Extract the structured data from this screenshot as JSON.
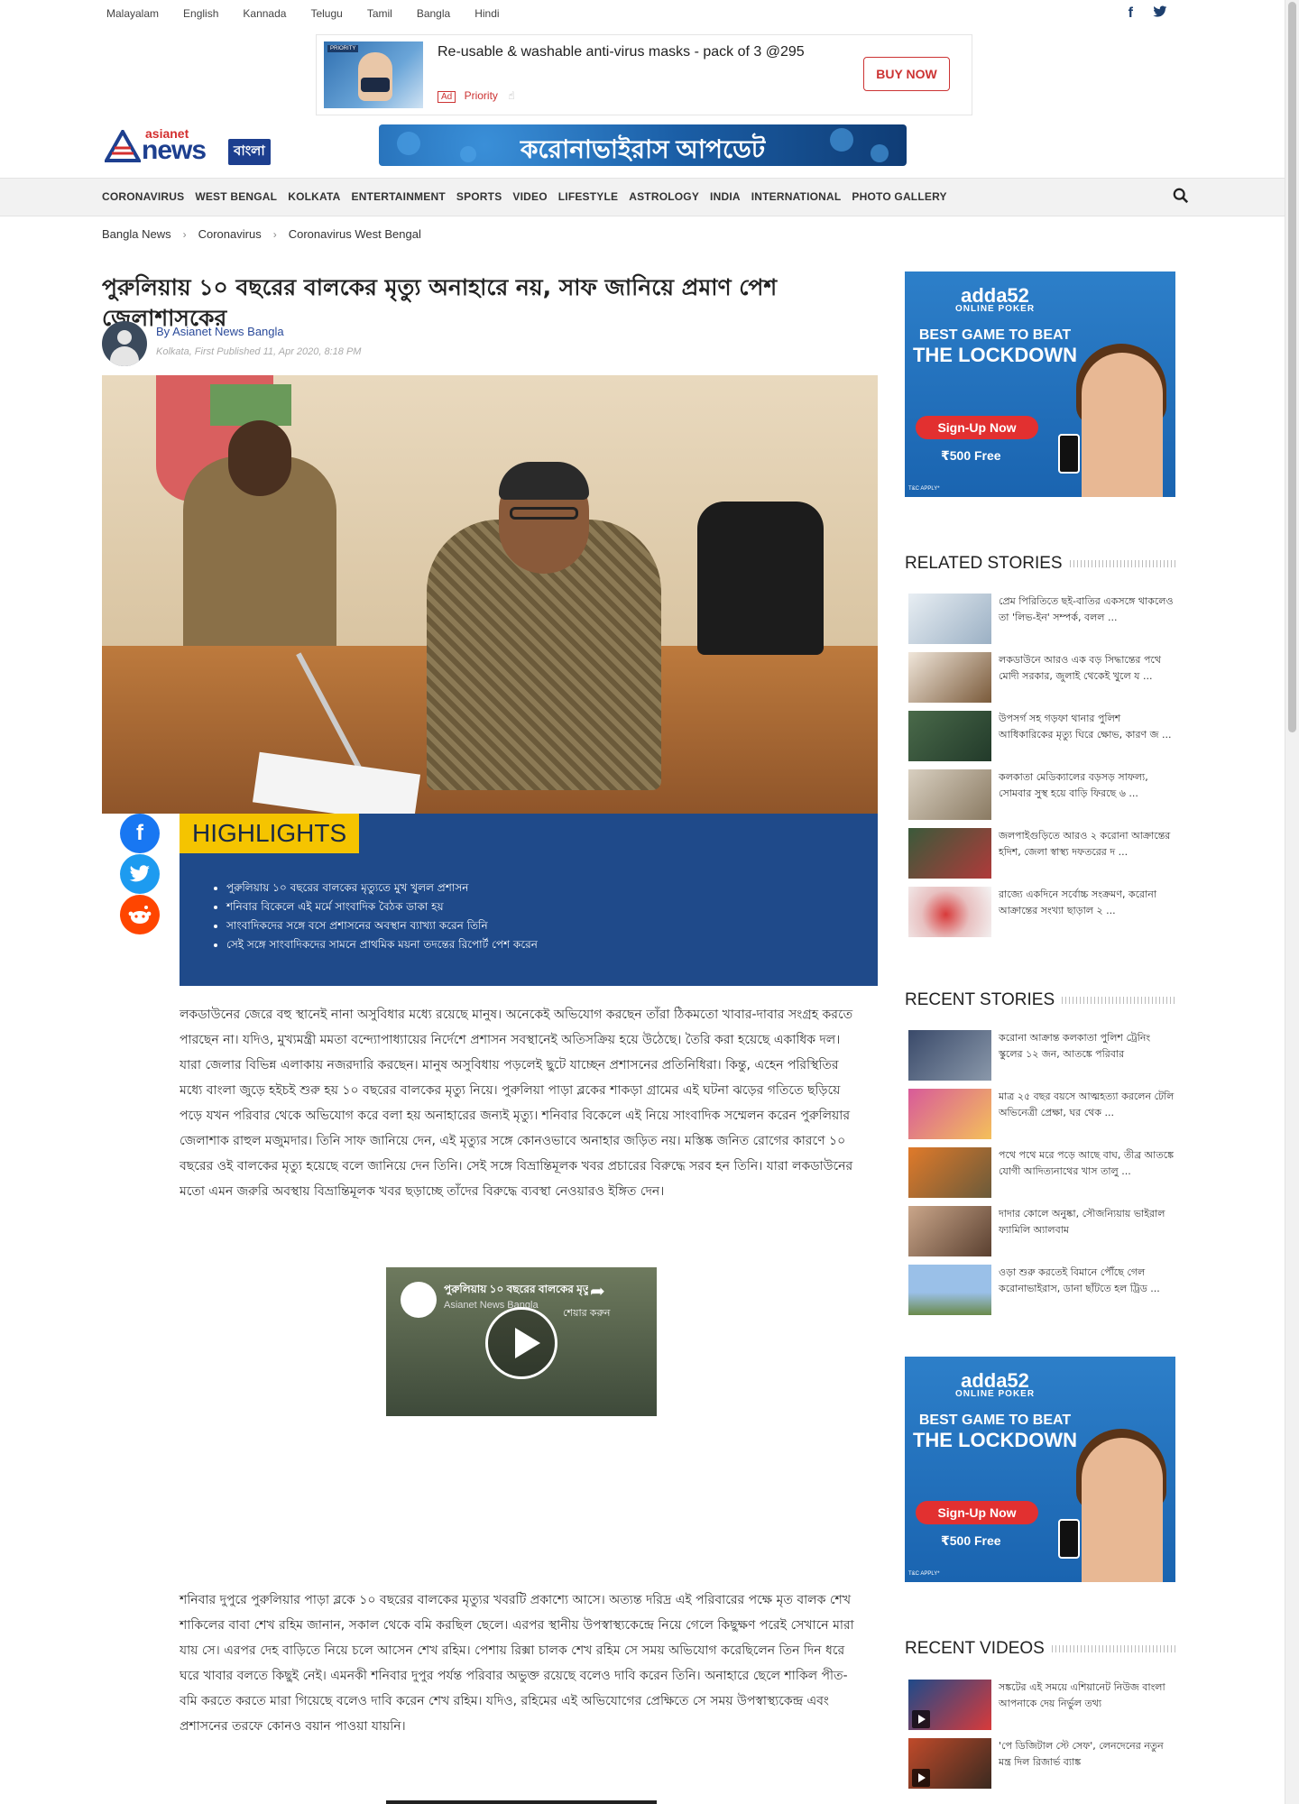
{
  "languages": [
    "Malayalam",
    "English",
    "Kannada",
    "Telugu",
    "Tamil",
    "Bangla",
    "Hindi"
  ],
  "social": {
    "facebook": "f",
    "twitter": "t"
  },
  "top_ad": {
    "thumb_tag": "PRIORITY",
    "title": "Re-usable & washable anti-virus masks - pack of 3 @295",
    "ad_badge": "Ad",
    "brand": "Priority",
    "button": "BUY NOW"
  },
  "logo": {
    "top": "asianet",
    "main": "news",
    "lang": "বাংলা"
  },
  "covid_banner": "করোনাভাইরাস আপডেট",
  "nav": [
    "CORONAVIRUS",
    "WEST BENGAL",
    "KOLKATA",
    "ENTERTAINMENT",
    "SPORTS",
    "VIDEO",
    "LIFESTYLE",
    "ASTROLOGY",
    "INDIA",
    "INTERNATIONAL",
    "PHOTO GALLERY"
  ],
  "breadcrumbs": [
    "Bangla News",
    "Coronavirus",
    "Coronavirus West Bengal"
  ],
  "article": {
    "headline": "পুরুলিয়ায় ১০ বছরের বালকের মৃত্যু অনাহারে নয়, সাফ জানিয়ে প্রমাণ পেশ জেলাশাসকের",
    "author": "By Asianet News Bangla",
    "date": "Kolkata, First Published 11, Apr 2020, 8:18 PM",
    "highlights_label": "HIGHLIGHTS",
    "highlights": [
      "পুরুলিয়ায় ১০ বছরের বালকের মৃত্যুতে মুখ খুলল প্রশাসন",
      "শনিবার বিকেলে এই মর্মে সাংবাদিক বৈঠক ডাকা হয়",
      "সাংবাদিকদের সঙ্গে বসে প্রশাসনের অবস্থান ব্যাখ্যা করেন তিনি",
      "সেই সঙ্গে সাংবাদিকদের সামনে প্রাথমিক ময়না তদন্তের রিপোর্ট পেশ করেন"
    ],
    "para1": "লকডাউনের জেরে বহু স্থানেই নানা অসুবিধার মধ্যে রয়েছে মানুষ। অনেকেই অভিযোগ করছেন তাঁরা ঠিকমতো খাবার-দাবার সংগ্রহ করতে পারছেন না। যদিও, মুখ্যমন্ত্রী মমতা বন্দ্যোপাধ্যায়ের নির্দেশে প্রশাসন সবস্থানেই অতিসক্রিয় হয়ে উঠেছে। তৈরি করা হয়েছে একাধিক দল। যারা জেলার বিভিন্ন এলাকায় নজরদারি করছেন। মানুষ অসুবিধায় পড়লেই ছুটে যাচ্ছেন প্রশাসনের প্রতিনিধিরা। কিন্তু, এহেন পরিস্থিতির মধ্যে বাংলা জুড়ে হইচই শুরু হয় ১০ বছরের বালকের মৃত্যু নিয়ে। পুরুলিয়া পাড়া ব্লকের শাকড়া গ্রামের এই ঘটনা ঝড়ের গতিতে ছড়িয়ে পড়ে যখন পরিবার থেকে অভিযোগ করে বলা হয় অনাহারের জন্যই মৃত্যু। শনিবার বিকেলে এই নিয়ে সাংবাদিক সম্মেলন করেন পুরুলিয়ার জেলাশাক রাহুল মজুমদার। তিনি সাফ জানিয়ে দেন, এই মৃত্যুর সঙ্গে কোনওভাবে অনাহার জড়িত নয়। মস্তিষ্ক জনিত রোগের কারণে ১০ বছরের ওই বালকের মৃত্যু হয়েছে বলে জানিয়ে দেন তিনি। সেই সঙ্গে বিভ্রান্তিমূলক খবর প্রচারের বিরুদ্ধে সরব হন তিনি। যারা লকডাউনের মতো এমন জরুরি অবস্থায় বিভ্রান্তিমূলক খবর ছড়াচ্ছে তাঁদের বিরুদ্ধে ব্যবস্থা নেওয়ারও ইঙ্গিত দেন।",
    "para2": "শনিবার দুপুরে পুরুলিয়ার পাড়া ব্লকে ১০ বছরের বালকের মৃত্যুর খবরটি প্রকাশ্যে আসে। অত্যন্ত দরিদ্র এই পরিবারের পক্ষে মৃত বালক শেখ শাকিলের বাবা শেখ রহিম জানান, সকাল থেকে বমি করছিল ছেলে। এরপর স্থানীয় উপস্বাস্থ্যকেন্দ্রে নিয়ে গেলে কিছুক্ষণ পরেই সেখানে মারা যায় সে। এরপর দেহ বাড়িতে নিয়ে চলে আসেন শেখ রহিম। পেশায় রিক্সা চালক শেখ রহিম সে সময় অভিযোগ করেছিলেন তিন দিন ধরে ঘরে খাবার বলতে কিছুই নেই। এমনকী শনিবার দুপুর পর্যন্ত পরিবার অভুক্ত রয়েছে বলেও দাবি করেন তিনি। অনাহারে ছেলে শাকিল পীত-বমি করতে করতে মারা গিয়েছে বলেও দাবি করেন শেখ রহিম। যদিও, রহিমের এই অভিযোগের প্রেক্ষিতে সে সময় উপস্বাস্থ্যকেন্দ্র এবং প্রশাসনের তরফে কোনও বয়ান পাওয়া যায়নি।"
  },
  "video": {
    "title": "পুরুলিয়ায় ১০ বছরের বালকের মৃত্যু ...",
    "channel": "Asianet News Bangla",
    "share_label": "শেয়ার করুন"
  },
  "side_ad": {
    "brand": "adda52",
    "brand_sub": "ONLINE POKER",
    "line1": "BEST GAME TO BEAT",
    "line2": "THE LOCKDOWN",
    "cta": "Sign-Up Now",
    "free": "₹500 Free",
    "tnc": "T&C APPLY*"
  },
  "related_title": "RELATED STORIES",
  "related": [
    "প্রেম পিরিতিতে ছই-বাতির একসঙ্গে থাকলেও তা 'লিভ-ইন' সম্পর্ক, বলল ...",
    "লকডাউনে আরও এক বড় সিদ্ধান্তের পথে মোদী সরকার, জুলাই থেকেই খুলে য ...",
    "উপসর্গ সহ গড়ফা থানার পুলিশ আধিকারিকের মৃত্যু ঘিরে ক্ষোভ, কারণ জ ...",
    "কলকাতা মেডিক্যালের বড়সড় সাফল্য, সোমবার সুস্থ হয়ে বাড়ি ফিরছে ৬ ...",
    "জলপাইগুড়িতে আরও ২ করোনা আক্রান্তের হদিশ, জেলা স্বাস্থ্য দফতরের দ ...",
    "রাজ্যে একদিনে সর্বোচ্চ সংক্রমণ, করোনা আক্রান্তের সংখ্যা ছাড়াল ২ ..."
  ],
  "recent_title": "RECENT STORIES",
  "recent": [
    "করোনা আক্রান্ত কলকাতা পুলিশ ট্রেনিং স্কুলের ১২ জন, আতঙ্কে পরিবার",
    "মাত্র ২৫ বছর বয়সে আত্মহত্যা করলেন টেলি অভিনেত্রী প্রেক্ষা, ঘর থেক ...",
    "পথে পথে মরে পড়ে আছে বাঘ, তীব্র আতঙ্কে যোগী আদিত্যনাথের খাস তালু ...",
    "দাদার কোলে অনুষ্কা, সৌজন্যিয়ায় ভাইরাল ফ্যামিলি অ্যালবাম",
    "ওড়া শুরু করতেই বিমানে পৌঁছে গেল করোনাভাইরাস, ডানা ছাঁটতে হল ট্রিড ..."
  ],
  "videos_title": "RECENT VIDEOS",
  "videos": [
    "সঙ্কটের এই সময়ে এশিয়ানেট নিউজ বাংলা আপনাকে দেয় নির্ভুল তথ্য",
    "'পে ডিজিটাল স্টে সেফ', লেনদেনের নতুন মন্ত্র দিল রিজার্ভ ব্যাঙ্ক"
  ]
}
